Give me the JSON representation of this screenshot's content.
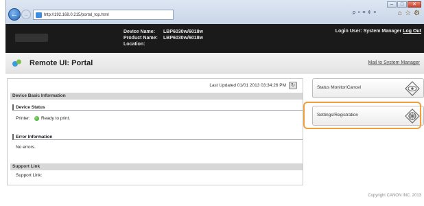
{
  "browser": {
    "url": "http://192.168.0.215/portal_top.html",
    "tools": "ρ • ≡ ¢ ×",
    "window_buttons": [
      "–",
      "□",
      "✕"
    ]
  },
  "device": {
    "name_label": "Device Name:",
    "name_value": "LBP6030w/6018w",
    "product_label": "Product Name:",
    "product_value": "LBP6030w/6018w",
    "location_label": "Location:",
    "location_value": "",
    "login_text": "Login User: System Manager",
    "logout_label": "Log Out"
  },
  "titlebar": {
    "title": "Remote UI: Portal",
    "mail_link": "Mail to System Manager"
  },
  "main": {
    "last_updated": "Last Updated 01/01 2013 03:34:26 PM",
    "device_basic_info": "Device Basic Information",
    "device_status_head": "Device Status",
    "printer_label": "Printer:",
    "printer_status": "Ready to print.",
    "error_head": "Error Information",
    "error_text": "No errors.",
    "support_head": "Support Link",
    "support_label": "Support Link:"
  },
  "side": {
    "status_monitor": "Status Monitor/Cancel",
    "settings": "Settings/Registration"
  },
  "footer": {
    "copyright": "Copyright CANON INC. 2013"
  },
  "colors": {
    "highlight": "#f0a03a",
    "header_bg": "#1a1a1a",
    "ready_green": "#2f9a1f"
  }
}
